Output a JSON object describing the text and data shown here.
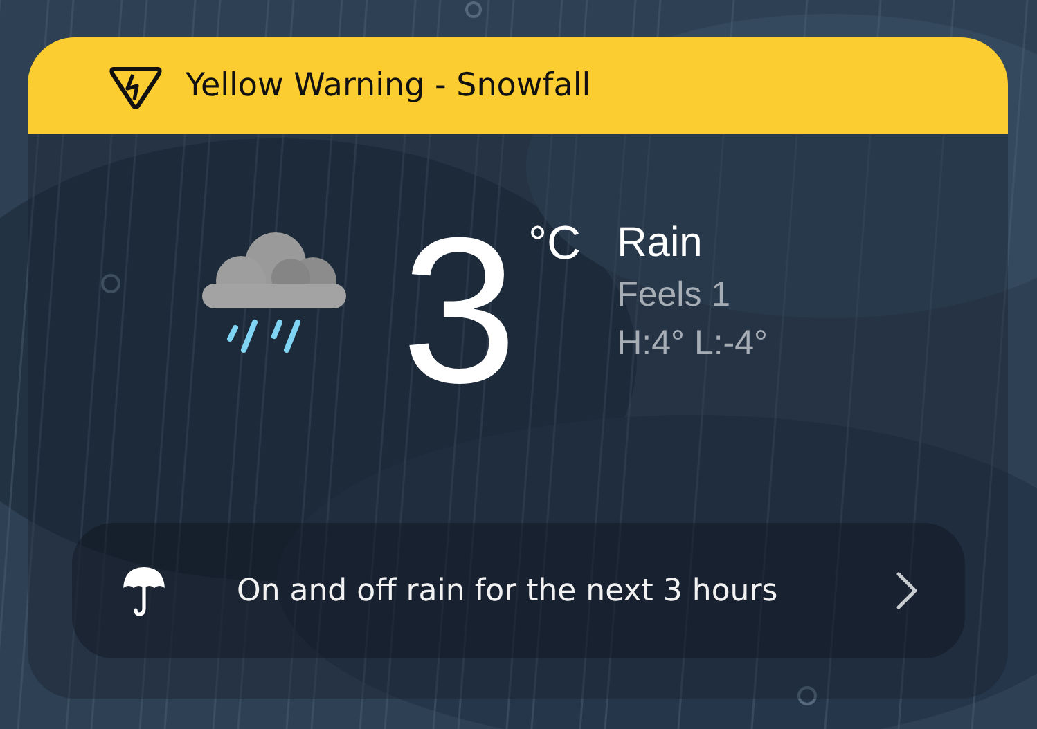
{
  "warning": {
    "title": "Yellow Warning - Snowfall"
  },
  "current": {
    "temperature": "3",
    "unit": "°C",
    "condition": "Rain",
    "feels": "Feels 1",
    "high_low": "H:4° L:-4°"
  },
  "forecast": {
    "text": "On and off rain for the next 3 hours"
  }
}
